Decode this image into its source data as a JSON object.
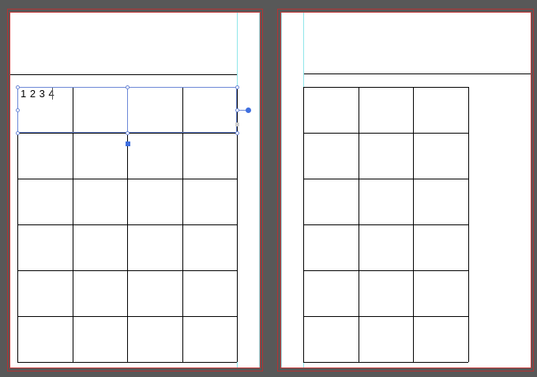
{
  "document": {
    "spread": {
      "pages": [
        {
          "id": "left",
          "table": {
            "rows": 6,
            "columns": 4
          }
        },
        {
          "id": "right",
          "table": {
            "rows": 6,
            "columns": 3
          }
        }
      ]
    },
    "selected_cell_text": "1 2 3 4",
    "colors": {
      "pasteboard": "#585858",
      "page": "#ffffff",
      "bleed_guide": "#c23a3a",
      "column_guide": "#8fe6ea",
      "selection": "#6b87d6",
      "handle_active": "#3f6fe0"
    }
  }
}
